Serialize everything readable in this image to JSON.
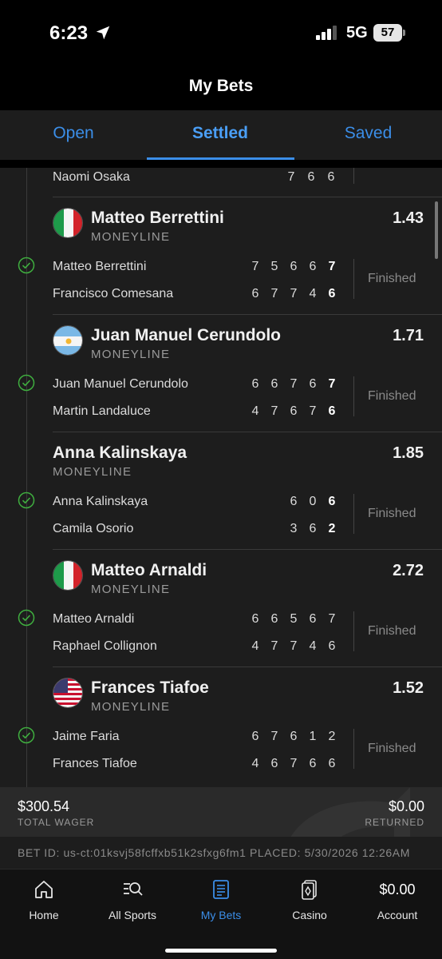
{
  "status_bar": {
    "time": "6:23",
    "network": "5G",
    "battery": "57"
  },
  "header": {
    "title": "My Bets"
  },
  "tabs": [
    {
      "label": "Open"
    },
    {
      "label": "Settled",
      "active": true
    },
    {
      "label": "Saved"
    }
  ],
  "top_partial": {
    "name": "Naomi Osaka",
    "scores": [
      "7",
      "6",
      "6"
    ]
  },
  "bets": [
    {
      "title": "Matteo Berrettini",
      "market": "MONEYLINE",
      "odds": "1.43",
      "flag": "italy-flag-icon",
      "rows": [
        {
          "name": "Matteo Berrettini",
          "scores": [
            "7",
            "5",
            "6",
            "6",
            "7"
          ]
        },
        {
          "name": "Francisco Comesana",
          "scores": [
            "6",
            "7",
            "7",
            "4",
            "6"
          ]
        }
      ],
      "status": "Finished"
    },
    {
      "title": "Juan Manuel Cerundolo",
      "market": "MONEYLINE",
      "odds": "1.71",
      "flag": "argentina-flag-icon",
      "rows": [
        {
          "name": "Juan Manuel Cerundolo",
          "scores": [
            "6",
            "6",
            "7",
            "6",
            "7"
          ]
        },
        {
          "name": "Martin Landaluce",
          "scores": [
            "4",
            "7",
            "6",
            "7",
            "6"
          ]
        }
      ],
      "status": "Finished"
    },
    {
      "title": "Anna Kalinskaya",
      "market": "MONEYLINE",
      "odds": "1.85",
      "flag": "",
      "rows": [
        {
          "name": "Anna Kalinskaya",
          "scores": [
            "6",
            "0",
            "6"
          ]
        },
        {
          "name": "Camila Osorio",
          "scores": [
            "3",
            "6",
            "2"
          ]
        }
      ],
      "status": "Finished"
    },
    {
      "title": "Matteo Arnaldi",
      "market": "MONEYLINE",
      "odds": "2.72",
      "flag": "italy-flag-icon",
      "rows": [
        {
          "name": "Matteo Arnaldi",
          "scores": [
            "6",
            "6",
            "5",
            "6",
            "7"
          ]
        },
        {
          "name": "Raphael Collignon",
          "scores": [
            "4",
            "7",
            "7",
            "4",
            "6"
          ]
        }
      ],
      "status": "Finished"
    },
    {
      "title": "Frances Tiafoe",
      "market": "MONEYLINE",
      "odds": "1.52",
      "flag": "usa-flag-icon",
      "rows": [
        {
          "name": "Jaime Faria",
          "scores": [
            "6",
            "7",
            "6",
            "1",
            "2"
          ]
        },
        {
          "name": "Frances Tiafoe",
          "scores": [
            "4",
            "6",
            "7",
            "6",
            "6"
          ]
        }
      ],
      "status": "Finished"
    }
  ],
  "summary": {
    "total_wager": "$300.54",
    "total_wager_label": "TOTAL WAGER",
    "returned": "$0.00",
    "returned_label": "RETURNED"
  },
  "bet_info": "BET ID: us-ct:01ksvj58fcffxb51k2sfxg6fm1 PLACED: 5/30/2026 12:26AM",
  "nav": {
    "home": "Home",
    "all_sports": "All Sports",
    "my_bets": "My Bets",
    "casino": "Casino",
    "account_amount": "$0.00",
    "account": "Account"
  },
  "colors": {
    "accent": "#3b8ee8",
    "success": "#3fae3f",
    "background": "#1d1d1d"
  }
}
